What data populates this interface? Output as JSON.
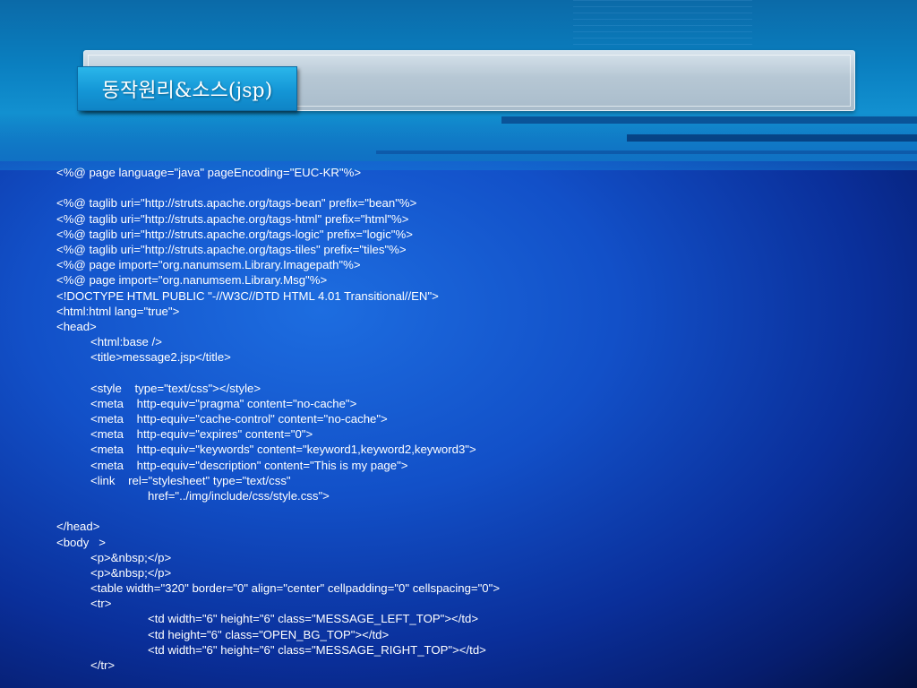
{
  "slide": {
    "title": "동작원리&소스(jsp)"
  },
  "code_lines": [
    "<%@ page language=\"java\" pageEncoding=\"EUC-KR\"%>",
    "",
    "<%@ taglib uri=\"http://struts.apache.org/tags-bean\" prefix=\"bean\"%>",
    "<%@ taglib uri=\"http://struts.apache.org/tags-html\" prefix=\"html\"%>",
    "<%@ taglib uri=\"http://struts.apache.org/tags-logic\" prefix=\"logic\"%>",
    "<%@ taglib uri=\"http://struts.apache.org/tags-tiles\" prefix=\"tiles\"%>",
    "<%@ page import=\"org.nanumsem.Library.Imagepath\"%>",
    "<%@ page import=\"org.nanumsem.Library.Msg\"%>",
    "<!DOCTYPE HTML PUBLIC \"-//W3C//DTD HTML 4.01 Transitional//EN\">",
    "<html:html lang=\"true\">",
    "<head>",
    "<html:base />",
    "<title>message2.jsp</title>",
    "",
    "<style    type=\"text/css\"></style>",
    "<meta    http-equiv=\"pragma\" content=\"no-cache\">",
    "<meta    http-equiv=\"cache-control\" content=\"no-cache\">",
    "<meta    http-equiv=\"expires\" content=\"0\">",
    "<meta    http-equiv=\"keywords\" content=\"keyword1,keyword2,keyword3\">",
    "<meta    http-equiv=\"description\" content=\"This is my page\">",
    "<link    rel=\"stylesheet\" type=\"text/css\"",
    "href=\"../img/include/css/style.css\">",
    "",
    "</head>",
    "<body   >",
    "<p>&nbsp;</p>",
    "<p>&nbsp;</p>",
    "<table width=\"320\" border=\"0\" align=\"center\" cellpadding=\"0\" cellspacing=\"0\">",
    "<tr>",
    "<td width=\"6\" height=\"6\" class=\"MESSAGE_LEFT_TOP\"></td>",
    "<td height=\"6\" class=\"OPEN_BG_TOP\"></td>",
    "<td width=\"6\" height=\"6\" class=\"MESSAGE_RIGHT_TOP\"></td>",
    "</tr>"
  ]
}
